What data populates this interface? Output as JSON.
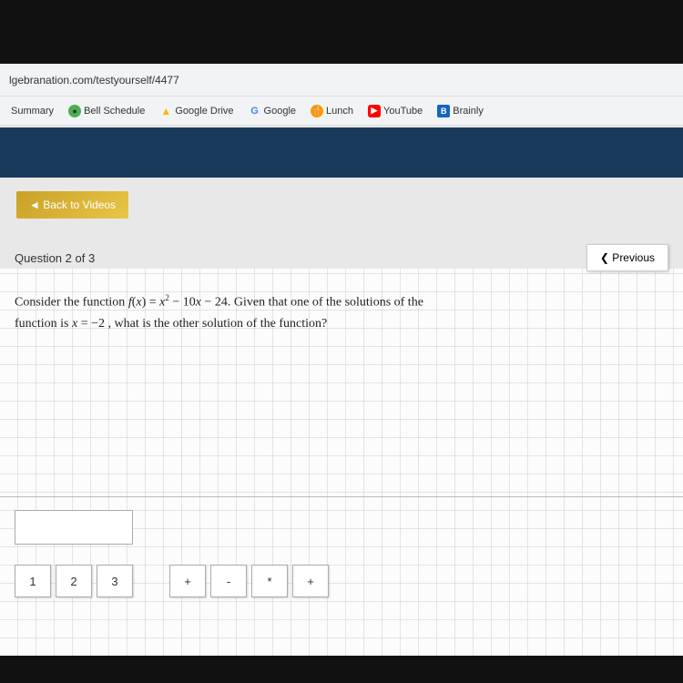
{
  "browser": {
    "address": "lgebranation.com/testyourself/4477",
    "bookmarks": [
      {
        "id": "summary",
        "label": "Summary",
        "icon": "",
        "icon_type": "none"
      },
      {
        "id": "bell-schedule",
        "label": "Bell Schedule",
        "icon": "●",
        "icon_type": "green-circle"
      },
      {
        "id": "google-drive",
        "label": "Google Drive",
        "icon": "▲",
        "icon_type": "drive"
      },
      {
        "id": "google",
        "label": "Google",
        "icon": "G",
        "icon_type": "google"
      },
      {
        "id": "lunch",
        "label": "Lunch",
        "icon": "🍴",
        "icon_type": "lunch"
      },
      {
        "id": "youtube",
        "label": "YouTube",
        "icon": "▶",
        "icon_type": "youtube"
      },
      {
        "id": "brainly",
        "label": "Brainly",
        "icon": "B",
        "icon_type": "brainly"
      }
    ]
  },
  "back_button": {
    "label": "◄ Back to Videos"
  },
  "question": {
    "number": "Question 2 of 3",
    "previous_label": "❮ Previous",
    "text_line1": "Consider the function f(x) = x² − 10x − 24. Given that one of the solutions of the",
    "text_line2": "function is x = −2 , what is the other solution of the function?",
    "answer_placeholder": ""
  },
  "keypad": {
    "keys": [
      "1",
      "2",
      "3",
      "+",
      "-",
      "*",
      "+"
    ]
  }
}
